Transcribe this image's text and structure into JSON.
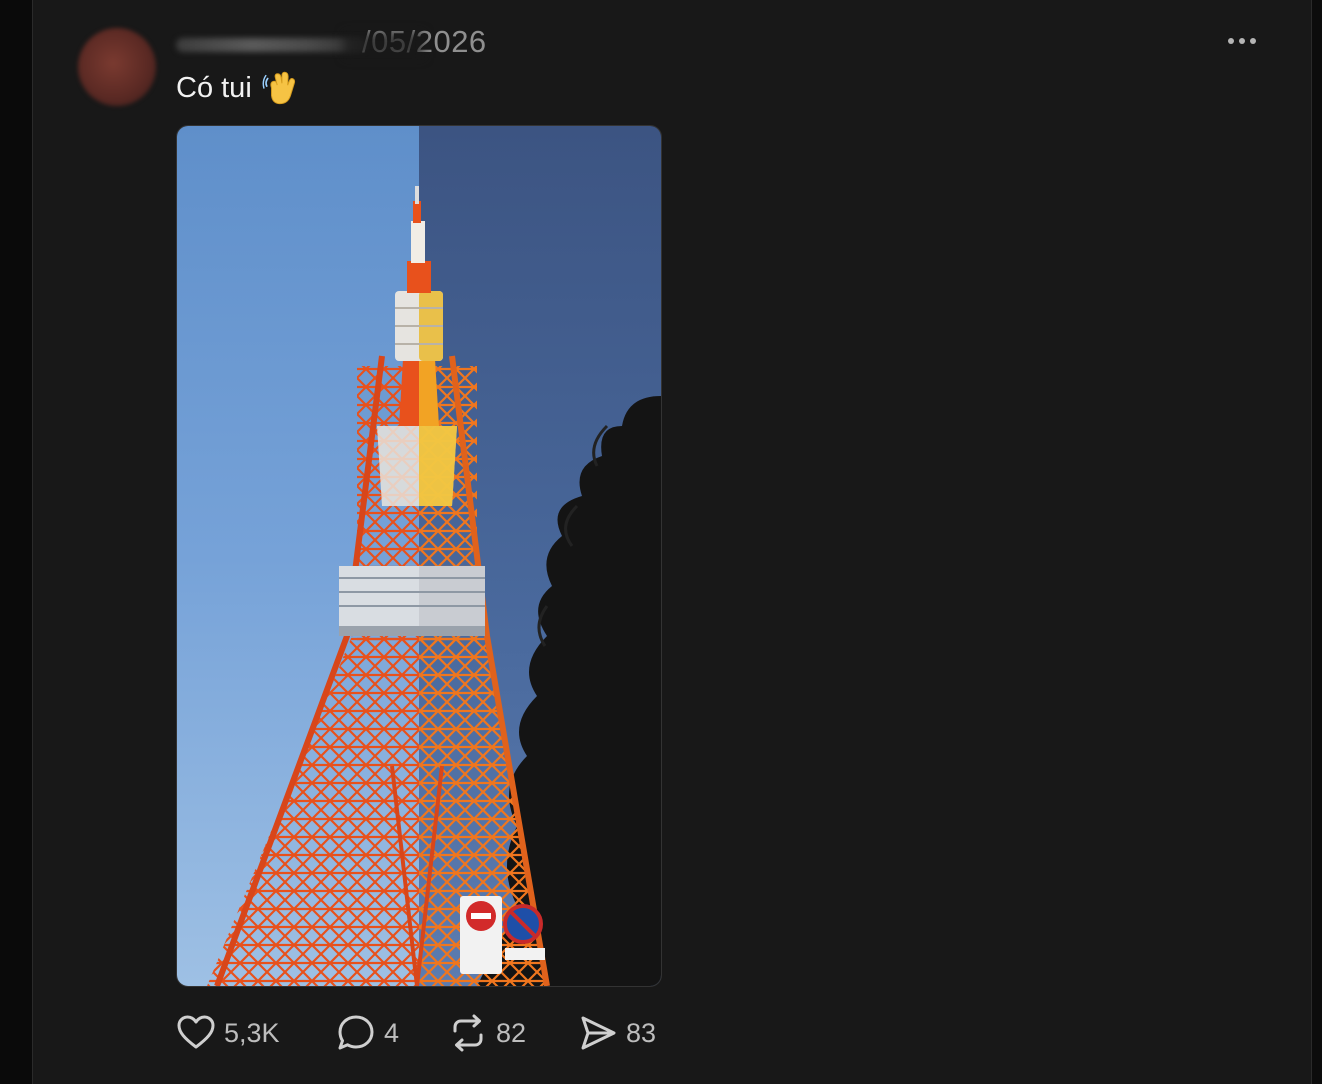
{
  "post": {
    "date": "/05/2026",
    "caption": "Có tui",
    "caption_emoji_icon": "waving-hand-icon",
    "more_icon": "more-horizontal-icon",
    "media_icon": "tokyo-tower-photo"
  },
  "actions": {
    "like": {
      "icon": "heart-icon",
      "count": "5,3K"
    },
    "comment": {
      "icon": "comment-icon",
      "count": "4"
    },
    "repost": {
      "icon": "repost-icon",
      "count": "82"
    },
    "share": {
      "icon": "send-icon",
      "count": "83"
    }
  },
  "colors": {
    "background": "#0c0c0c",
    "card": "#181818",
    "text_primary": "#f2f2f2",
    "text_secondary": "#bdbdbd",
    "sky": "#7aa3d6",
    "tower_orange": "#e2541f"
  }
}
